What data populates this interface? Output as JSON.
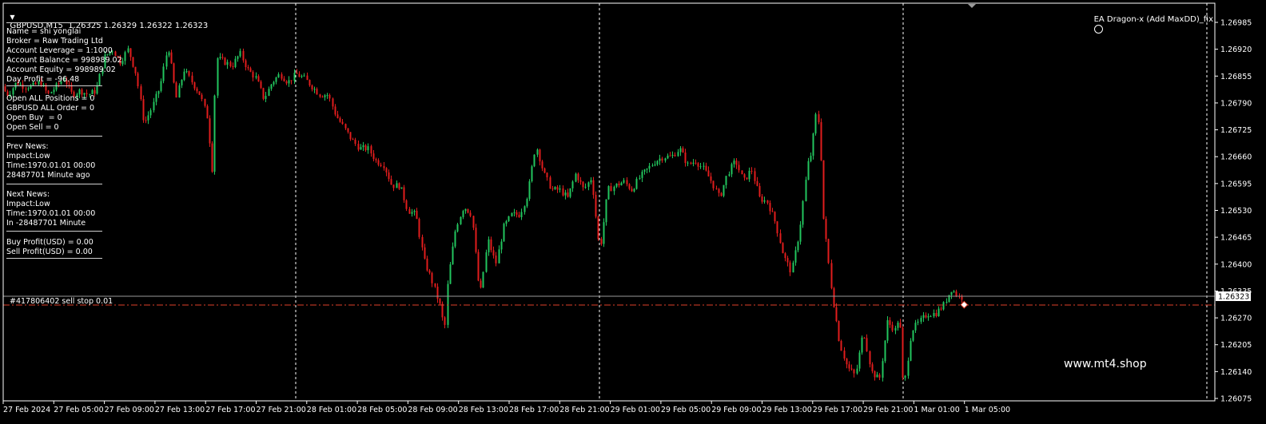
{
  "header": {
    "symbol_line": "GBPUSD,M15  1.26325 1.26329 1.26322 1.26323",
    "ea_title": "EA Dragon-x (Add MaxDD)_fix"
  },
  "info_panel": {
    "lines": [
      "Name = shi yonglai",
      "Broker = Raw Trading Ltd",
      "Account Leverage = 1:1000",
      "Account Balance = 998989.02",
      "Account Equity = 998989.02",
      "Day Profit = -96.48",
      "Open ALL Positions = 0",
      "GBPUSD ALL Order = 0",
      "Open Buy  = 0",
      "Open Sell = 0",
      "Prev News:",
      "Impact:Low",
      "Time:1970.01.01 00:00",
      "28487701 Minute ago",
      "Next News:",
      "Impact:Low",
      "Time:1970.01.01 00:00",
      "In -28487701 Minute",
      "Buy Profit(USD) = 0.00",
      "Sell Profit(USD) = 0.00"
    ]
  },
  "order_label": "#417806402 sell stop 0.01",
  "watermark": "www.mt4.shop",
  "colors": {
    "bull": "#22c55e",
    "bear": "#e11d1d",
    "order_line": "#e0402a",
    "price_line": "#9a9a9a",
    "grid_vline": "#ffffff"
  },
  "chart_data": {
    "type": "candlestick",
    "symbol": "GBPUSD",
    "timeframe": "M15",
    "current_price": "1.26323",
    "order_price": 1.26302,
    "yticks": [
      "1.26985",
      "1.26920",
      "1.26855",
      "1.26790",
      "1.26725",
      "1.26660",
      "1.26595",
      "1.26530",
      "1.26465",
      "1.26400",
      "1.26335",
      "1.26270",
      "1.26205",
      "1.26140",
      "1.26075"
    ],
    "ylim": [
      1.26075,
      1.26985
    ],
    "xticks": [
      "27 Feb 2024",
      "27 Feb 05:00",
      "27 Feb 09:00",
      "27 Feb 13:00",
      "27 Feb 17:00",
      "27 Feb 21:00",
      "28 Feb 01:00",
      "28 Feb 05:00",
      "28 Feb 09:00",
      "28 Feb 13:00",
      "28 Feb 17:00",
      "28 Feb 21:00",
      "29 Feb 01:00",
      "29 Feb 05:00",
      "29 Feb 09:00",
      "29 Feb 13:00",
      "29 Feb 17:00",
      "29 Feb 21:00",
      "1 Mar 01:00",
      "1 Mar 05:00"
    ],
    "day_separators": [
      "28 Feb 00:00",
      "29 Feb 00:00",
      "1 Mar 00:00"
    ],
    "path": [
      [
        0,
        1.2683
      ],
      [
        10,
        1.2681
      ],
      [
        20,
        1.2684
      ],
      [
        30,
        1.2683
      ],
      [
        40,
        1.2683
      ],
      [
        50,
        1.2684
      ],
      [
        60,
        1.2681
      ],
      [
        70,
        1.2683
      ],
      [
        80,
        1.2685
      ],
      [
        90,
        1.2681
      ],
      [
        100,
        1.2682
      ],
      [
        110,
        1.2681
      ],
      [
        120,
        1.2682
      ],
      [
        130,
        1.269
      ],
      [
        140,
        1.2692
      ],
      [
        150,
        1.2689
      ],
      [
        160,
        1.2692
      ],
      [
        170,
        1.2686
      ],
      [
        180,
        1.2674
      ],
      [
        190,
        1.2678
      ],
      [
        200,
        1.2683
      ],
      [
        210,
        1.2693
      ],
      [
        220,
        1.268
      ],
      [
        230,
        1.2687
      ],
      [
        240,
        1.2684
      ],
      [
        250,
        1.2681
      ],
      [
        260,
        1.2675
      ],
      [
        265,
        1.2662
      ],
      [
        270,
        1.269
      ],
      [
        280,
        1.2689
      ],
      [
        290,
        1.2688
      ],
      [
        300,
        1.2691
      ],
      [
        310,
        1.2687
      ],
      [
        320,
        1.2685
      ],
      [
        330,
        1.268
      ],
      [
        340,
        1.2684
      ],
      [
        350,
        1.2686
      ],
      [
        360,
        1.2684
      ],
      [
        370,
        1.2686
      ],
      [
        380,
        1.2685
      ],
      [
        390,
        1.2683
      ],
      [
        400,
        1.2681
      ],
      [
        410,
        1.2681
      ],
      [
        420,
        1.2676
      ],
      [
        430,
        1.2673
      ],
      [
        440,
        1.267
      ],
      [
        450,
        1.2668
      ],
      [
        460,
        1.2668
      ],
      [
        470,
        1.2665
      ],
      [
        480,
        1.2664
      ],
      [
        490,
        1.2659
      ],
      [
        500,
        1.2659
      ],
      [
        510,
        1.2653
      ],
      [
        520,
        1.2652
      ],
      [
        530,
        1.2641
      ],
      [
        540,
        1.2636
      ],
      [
        550,
        1.263
      ],
      [
        556,
        1.2624
      ],
      [
        560,
        1.2636
      ],
      [
        570,
        1.2649
      ],
      [
        580,
        1.2654
      ],
      [
        590,
        1.2652
      ],
      [
        600,
        1.2632
      ],
      [
        610,
        1.2646
      ],
      [
        620,
        1.264
      ],
      [
        630,
        1.2649
      ],
      [
        640,
        1.2652
      ],
      [
        650,
        1.2652
      ],
      [
        660,
        1.2657
      ],
      [
        670,
        1.2669
      ],
      [
        680,
        1.2662
      ],
      [
        690,
        1.2658
      ],
      [
        700,
        1.2658
      ],
      [
        710,
        1.2656
      ],
      [
        720,
        1.2662
      ],
      [
        730,
        1.2658
      ],
      [
        740,
        1.2661
      ],
      [
        750,
        1.2643
      ],
      [
        760,
        1.2658
      ],
      [
        770,
        1.2659
      ],
      [
        780,
        1.266
      ],
      [
        790,
        1.2658
      ],
      [
        800,
        1.2661
      ],
      [
        810,
        1.2663
      ],
      [
        820,
        1.2665
      ],
      [
        830,
        1.2666
      ],
      [
        840,
        1.2666
      ],
      [
        850,
        1.2668
      ],
      [
        860,
        1.2664
      ],
      [
        870,
        1.2665
      ],
      [
        880,
        1.2663
      ],
      [
        890,
        1.266
      ],
      [
        900,
        1.2656
      ],
      [
        910,
        1.2662
      ],
      [
        920,
        1.2665
      ],
      [
        930,
        1.266
      ],
      [
        940,
        1.2663
      ],
      [
        950,
        1.2656
      ],
      [
        960,
        1.2655
      ],
      [
        970,
        1.265
      ],
      [
        980,
        1.2642
      ],
      [
        990,
        1.2638
      ],
      [
        1000,
        1.2648
      ],
      [
        1010,
        1.2664
      ],
      [
        1015,
        1.2667
      ],
      [
        1020,
        1.2676
      ],
      [
        1025,
        1.2674
      ],
      [
        1030,
        1.2651
      ],
      [
        1040,
        1.2634
      ],
      [
        1050,
        1.2621
      ],
      [
        1060,
        1.2615
      ],
      [
        1070,
        1.2613
      ],
      [
        1080,
        1.2624
      ],
      [
        1090,
        1.2614
      ],
      [
        1100,
        1.2612
      ],
      [
        1110,
        1.2626
      ],
      [
        1120,
        1.2624
      ],
      [
        1125,
        1.2628
      ],
      [
        1130,
        1.2609
      ],
      [
        1140,
        1.2624
      ],
      [
        1150,
        1.2626
      ],
      [
        1160,
        1.2628
      ],
      [
        1170,
        1.2628
      ],
      [
        1180,
        1.263
      ],
      [
        1190,
        1.2634
      ],
      [
        1200,
        1.2632
      ],
      [
        1206,
        1.2632
      ]
    ]
  }
}
